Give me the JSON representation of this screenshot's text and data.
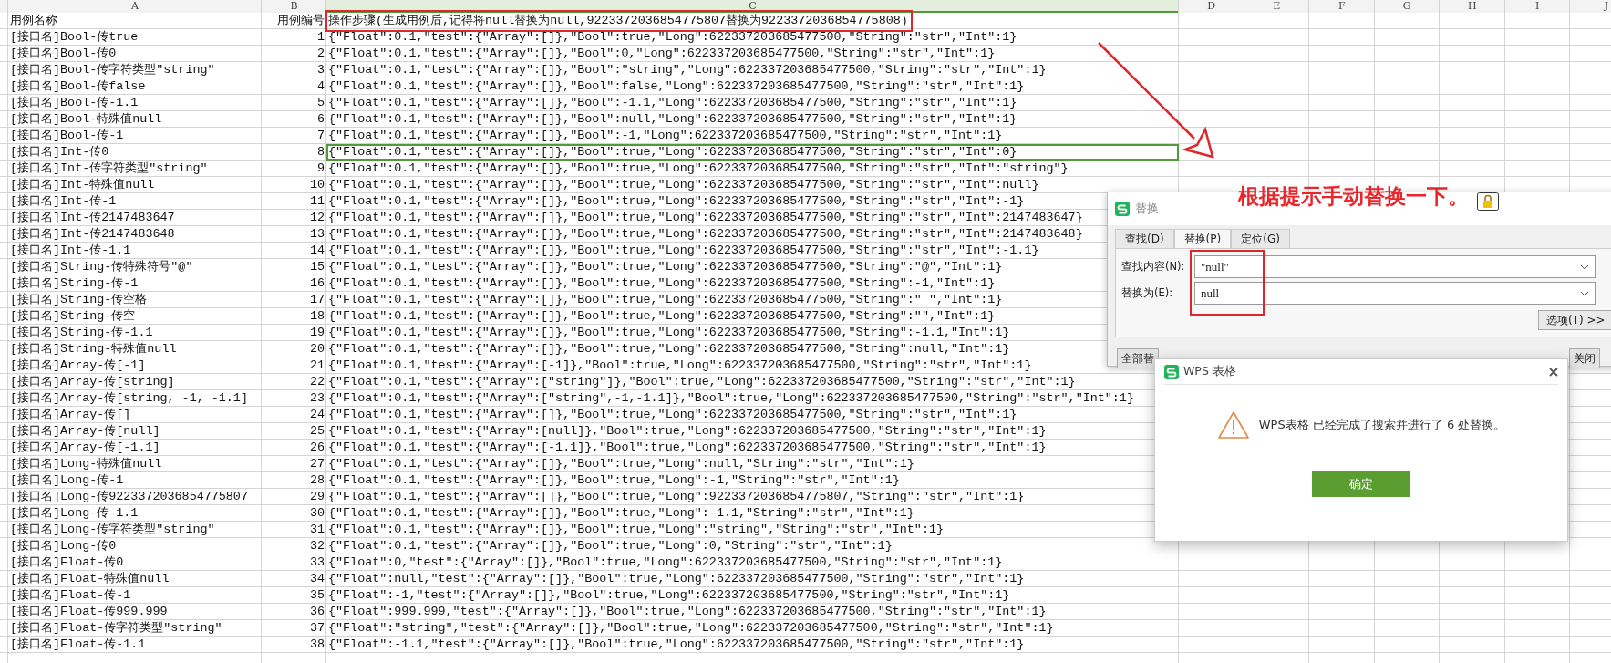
{
  "columns": [
    {
      "label": "A",
      "selected": false
    },
    {
      "label": "B",
      "selected": false
    },
    {
      "label": "C",
      "selected": true
    },
    {
      "label": "D",
      "selected": false
    },
    {
      "label": "E",
      "selected": false
    },
    {
      "label": "F",
      "selected": false
    },
    {
      "label": "G",
      "selected": false
    },
    {
      "label": "H",
      "selected": false
    },
    {
      "label": "I",
      "selected": false
    },
    {
      "label": "J",
      "selected": false
    }
  ],
  "header_row": {
    "case_name": "用例名称",
    "case_no": "用例编号",
    "steps": "操作步骤(生成用例后,记得将null替换为null,9223372036854775807替换为9223372036854775808)"
  },
  "rows": [
    {
      "name": "[接口名]Bool-传true",
      "no": "1",
      "steps": "{\"Float\":0.1,\"test\":{\"Array\":[]},\"Bool\":true,\"Long\":622337203685477500,\"String\":\"str\",\"Int\":1}",
      "selected": false
    },
    {
      "name": "[接口名]Bool-传0",
      "no": "2",
      "steps": "{\"Float\":0.1,\"test\":{\"Array\":[]},\"Bool\":0,\"Long\":622337203685477500,\"String\":\"str\",\"Int\":1}",
      "selected": false
    },
    {
      "name": "[接口名]Bool-传字符类型\"string\"",
      "no": "3",
      "steps": "{\"Float\":0.1,\"test\":{\"Array\":[]},\"Bool\":\"string\",\"Long\":622337203685477500,\"String\":\"str\",\"Int\":1}",
      "selected": false
    },
    {
      "name": "[接口名]Bool-传false",
      "no": "4",
      "steps": "{\"Float\":0.1,\"test\":{\"Array\":[]},\"Bool\":false,\"Long\":622337203685477500,\"String\":\"str\",\"Int\":1}",
      "selected": false
    },
    {
      "name": "[接口名]Bool-传-1.1",
      "no": "5",
      "steps": "{\"Float\":0.1,\"test\":{\"Array\":[]},\"Bool\":-1.1,\"Long\":622337203685477500,\"String\":\"str\",\"Int\":1}",
      "selected": false
    },
    {
      "name": "[接口名]Bool-特殊值null",
      "no": "6",
      "steps": "{\"Float\":0.1,\"test\":{\"Array\":[]},\"Bool\":null,\"Long\":622337203685477500,\"String\":\"str\",\"Int\":1}",
      "selected": false
    },
    {
      "name": "[接口名]Bool-传-1",
      "no": "7",
      "steps": "{\"Float\":0.1,\"test\":{\"Array\":[]},\"Bool\":-1,\"Long\":622337203685477500,\"String\":\"str\",\"Int\":1}",
      "selected": false
    },
    {
      "name": "[接口名]Int-传0",
      "no": "8",
      "steps": "{\"Float\":0.1,\"test\":{\"Array\":[]},\"Bool\":true,\"Long\":622337203685477500,\"String\":\"str\",\"Int\":0}",
      "selected": true
    },
    {
      "name": "[接口名]Int-传字符类型\"string\"",
      "no": "9",
      "steps": "{\"Float\":0.1,\"test\":{\"Array\":[]},\"Bool\":true,\"Long\":622337203685477500,\"String\":\"str\",\"Int\":\"string\"}",
      "selected": false
    },
    {
      "name": "[接口名]Int-特殊值null",
      "no": "10",
      "steps": "{\"Float\":0.1,\"test\":{\"Array\":[]},\"Bool\":true,\"Long\":622337203685477500,\"String\":\"str\",\"Int\":null}",
      "selected": false
    },
    {
      "name": "[接口名]Int-传-1",
      "no": "11",
      "steps": "{\"Float\":0.1,\"test\":{\"Array\":[]},\"Bool\":true,\"Long\":622337203685477500,\"String\":\"str\",\"Int\":-1}",
      "selected": false
    },
    {
      "name": "[接口名]Int-传2147483647",
      "no": "12",
      "steps": "{\"Float\":0.1,\"test\":{\"Array\":[]},\"Bool\":true,\"Long\":622337203685477500,\"String\":\"str\",\"Int\":2147483647}",
      "selected": false
    },
    {
      "name": "[接口名]Int-传2147483648",
      "no": "13",
      "steps": "{\"Float\":0.1,\"test\":{\"Array\":[]},\"Bool\":true,\"Long\":622337203685477500,\"String\":\"str\",\"Int\":2147483648}",
      "selected": false
    },
    {
      "name": "[接口名]Int-传-1.1",
      "no": "14",
      "steps": "{\"Float\":0.1,\"test\":{\"Array\":[]},\"Bool\":true,\"Long\":622337203685477500,\"String\":\"str\",\"Int\":-1.1}",
      "selected": false
    },
    {
      "name": "[接口名]String-传特殊符号\"@\"",
      "no": "15",
      "steps": "{\"Float\":0.1,\"test\":{\"Array\":[]},\"Bool\":true,\"Long\":622337203685477500,\"String\":\"@\",\"Int\":1}",
      "selected": false
    },
    {
      "name": "[接口名]String-传-1",
      "no": "16",
      "steps": "{\"Float\":0.1,\"test\":{\"Array\":[]},\"Bool\":true,\"Long\":622337203685477500,\"String\":-1,\"Int\":1}",
      "selected": false
    },
    {
      "name": "[接口名]String-传空格",
      "no": "17",
      "steps": "{\"Float\":0.1,\"test\":{\"Array\":[]},\"Bool\":true,\"Long\":622337203685477500,\"String\":\" \",\"Int\":1}",
      "selected": false
    },
    {
      "name": "[接口名]String-传空",
      "no": "18",
      "steps": "{\"Float\":0.1,\"test\":{\"Array\":[]},\"Bool\":true,\"Long\":622337203685477500,\"String\":\"\",\"Int\":1}",
      "selected": false
    },
    {
      "name": "[接口名]String-传-1.1",
      "no": "19",
      "steps": "{\"Float\":0.1,\"test\":{\"Array\":[]},\"Bool\":true,\"Long\":622337203685477500,\"String\":-1.1,\"Int\":1}",
      "selected": false
    },
    {
      "name": "[接口名]String-特殊值null",
      "no": "20",
      "steps": "{\"Float\":0.1,\"test\":{\"Array\":[]},\"Bool\":true,\"Long\":622337203685477500,\"String\":null,\"Int\":1}",
      "selected": false
    },
    {
      "name": "[接口名]Array-传[-1]",
      "no": "21",
      "steps": "{\"Float\":0.1,\"test\":{\"Array\":[-1]},\"Bool\":true,\"Long\":622337203685477500,\"String\":\"str\",\"Int\":1}",
      "selected": false
    },
    {
      "name": "[接口名]Array-传[string]",
      "no": "22",
      "steps": "{\"Float\":0.1,\"test\":{\"Array\":[\"string\"]},\"Bool\":true,\"Long\":622337203685477500,\"String\":\"str\",\"Int\":1}",
      "selected": false
    },
    {
      "name": "[接口名]Array-传[string, -1, -1.1]",
      "no": "23",
      "steps": "{\"Float\":0.1,\"test\":{\"Array\":[\"string\",-1,-1.1]},\"Bool\":true,\"Long\":622337203685477500,\"String\":\"str\",\"Int\":1}",
      "selected": false
    },
    {
      "name": "[接口名]Array-传[]",
      "no": "24",
      "steps": "{\"Float\":0.1,\"test\":{\"Array\":[]},\"Bool\":true,\"Long\":622337203685477500,\"String\":\"str\",\"Int\":1}",
      "selected": false
    },
    {
      "name": "[接口名]Array-传[null]",
      "no": "25",
      "steps": "{\"Float\":0.1,\"test\":{\"Array\":[null]},\"Bool\":true,\"Long\":622337203685477500,\"String\":\"str\",\"Int\":1}",
      "selected": false
    },
    {
      "name": "[接口名]Array-传[-1.1]",
      "no": "26",
      "steps": "{\"Float\":0.1,\"test\":{\"Array\":[-1.1]},\"Bool\":true,\"Long\":622337203685477500,\"String\":\"str\",\"Int\":1}",
      "selected": false
    },
    {
      "name": "[接口名]Long-特殊值null",
      "no": "27",
      "steps": "{\"Float\":0.1,\"test\":{\"Array\":[]},\"Bool\":true,\"Long\":null,\"String\":\"str\",\"Int\":1}",
      "selected": false
    },
    {
      "name": "[接口名]Long-传-1",
      "no": "28",
      "steps": "{\"Float\":0.1,\"test\":{\"Array\":[]},\"Bool\":true,\"Long\":-1,\"String\":\"str\",\"Int\":1}",
      "selected": false
    },
    {
      "name": "[接口名]Long-传9223372036854775807",
      "no": "29",
      "steps": "{\"Float\":0.1,\"test\":{\"Array\":[]},\"Bool\":true,\"Long\":9223372036854775807,\"String\":\"str\",\"Int\":1}",
      "selected": false
    },
    {
      "name": "[接口名]Long-传-1.1",
      "no": "30",
      "steps": "{\"Float\":0.1,\"test\":{\"Array\":[]},\"Bool\":true,\"Long\":-1.1,\"String\":\"str\",\"Int\":1}",
      "selected": false
    },
    {
      "name": "[接口名]Long-传字符类型\"string\"",
      "no": "31",
      "steps": "{\"Float\":0.1,\"test\":{\"Array\":[]},\"Bool\":true,\"Long\":\"string\",\"String\":\"str\",\"Int\":1}",
      "selected": false
    },
    {
      "name": "[接口名]Long-传0",
      "no": "32",
      "steps": "{\"Float\":0.1,\"test\":{\"Array\":[]},\"Bool\":true,\"Long\":0,\"String\":\"str\",\"Int\":1}",
      "selected": false
    },
    {
      "name": "[接口名]Float-传0",
      "no": "33",
      "steps": "{\"Float\":0,\"test\":{\"Array\":[]},\"Bool\":true,\"Long\":622337203685477500,\"String\":\"str\",\"Int\":1}",
      "selected": false
    },
    {
      "name": "[接口名]Float-特殊值null",
      "no": "34",
      "steps": "{\"Float\":null,\"test\":{\"Array\":[]},\"Bool\":true,\"Long\":622337203685477500,\"String\":\"str\",\"Int\":1}",
      "selected": false
    },
    {
      "name": "[接口名]Float-传-1",
      "no": "35",
      "steps": "{\"Float\":-1,\"test\":{\"Array\":[]},\"Bool\":true,\"Long\":622337203685477500,\"String\":\"str\",\"Int\":1}",
      "selected": false
    },
    {
      "name": "[接口名]Float-传999.999",
      "no": "36",
      "steps": "{\"Float\":999.999,\"test\":{\"Array\":[]},\"Bool\":true,\"Long\":622337203685477500,\"String\":\"str\",\"Int\":1}",
      "selected": false
    },
    {
      "name": "[接口名]Float-传字符类型\"string\"",
      "no": "37",
      "steps": "{\"Float\":\"string\",\"test\":{\"Array\":[]},\"Bool\":true,\"Long\":622337203685477500,\"String\":\"str\",\"Int\":1}",
      "selected": false
    },
    {
      "name": "[接口名]Float-传-1.1",
      "no": "38",
      "steps": "{\"Float\":-1.1,\"test\":{\"Array\":[]},\"Bool\":true,\"Long\":622337203685477500,\"String\":\"str\",\"Int\":1}",
      "selected": false
    }
  ],
  "annotation": {
    "text": "根据提示手动替换一下。"
  },
  "replace_dialog": {
    "title": "替换",
    "tabs": [
      {
        "label": "查找(D)",
        "selected": false
      },
      {
        "label": "替换(P)",
        "selected": true
      },
      {
        "label": "定位(G)",
        "selected": false
      }
    ],
    "fields": [
      {
        "label": "查找内容(N):",
        "value": "\"null\""
      },
      {
        "label": "替换为(E):",
        "value": "null"
      }
    ],
    "options_button": "选项(T) >>",
    "bottom_buttons": [
      "全部替",
      "关闭"
    ]
  },
  "alert_dialog": {
    "title": "WPS 表格",
    "message": "WPS表格 已经完成了搜索并进行了 6 处替换。",
    "button": "确定"
  }
}
